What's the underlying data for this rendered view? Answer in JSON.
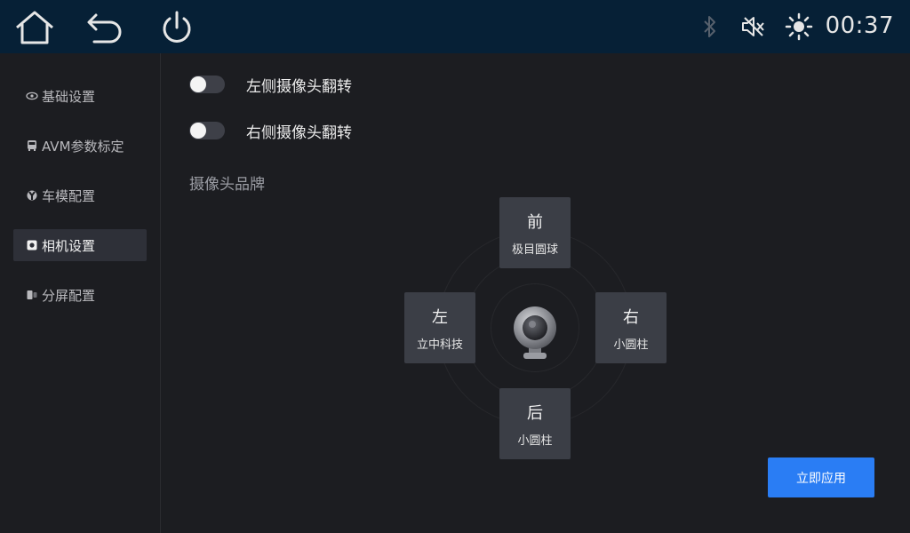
{
  "status_bar": {
    "clock": "00:37",
    "icons": [
      "home-icon",
      "back-icon",
      "power-icon",
      "bluetooth-icon",
      "volume-mute-icon",
      "brightness-icon"
    ]
  },
  "sidebar": {
    "items": [
      {
        "label": "基础设置",
        "icon": "eye-icon",
        "active": false
      },
      {
        "label": "AVM参数标定",
        "icon": "car-icon",
        "active": false
      },
      {
        "label": "车模配置",
        "icon": "model-icon",
        "active": false
      },
      {
        "label": "相机设置",
        "icon": "camera-icon",
        "active": true
      },
      {
        "label": "分屏配置",
        "icon": "split-icon",
        "active": false
      }
    ]
  },
  "main": {
    "toggles": [
      {
        "label": "左侧摄像头翻转",
        "on": false
      },
      {
        "label": "右侧摄像头翻转",
        "on": false
      }
    ],
    "section_title": "摄像头品牌",
    "cameras": {
      "front": {
        "position": "前",
        "brand": "极目圆球"
      },
      "left": {
        "position": "左",
        "brand": "立中科技"
      },
      "right": {
        "position": "右",
        "brand": "小圆柱"
      },
      "rear": {
        "position": "后",
        "brand": "小圆柱"
      }
    },
    "apply_label": "立即应用"
  },
  "colors": {
    "status_bar_bg": "#062036",
    "background": "#1c1d21",
    "accent": "#2a7df4",
    "tile": "#3b3e46"
  }
}
